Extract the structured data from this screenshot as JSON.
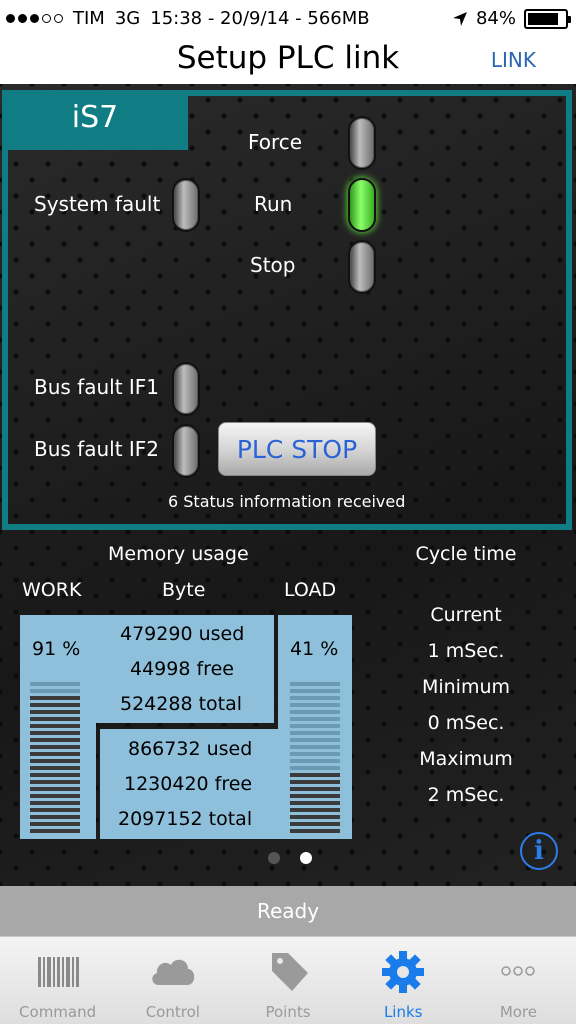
{
  "status_bar": {
    "carrier": "TIM",
    "network": "3G",
    "center_text": "15:38 - 20/9/14 - 566MB",
    "battery": "84%",
    "battery_level": 0.84,
    "signal_bars_filled": 3,
    "signal_bars_total": 5
  },
  "nav": {
    "title": "Setup PLC link",
    "right_button": "LINK"
  },
  "plc": {
    "name": "iS7",
    "indicators": {
      "force": {
        "label": "Force",
        "on": false
      },
      "system_fault": {
        "label": "System fault",
        "on": false
      },
      "run": {
        "label": "Run",
        "on": true
      },
      "stop": {
        "label": "Stop",
        "on": false
      },
      "bus_fault_if1": {
        "label": "Bus fault IF1",
        "on": false
      },
      "bus_fault_if2": {
        "label": "Bus fault IF2",
        "on": false
      }
    },
    "stop_button": "PLC STOP",
    "status_info": "6 Status information received"
  },
  "memory": {
    "title": "Memory usage",
    "work_label": "WORK",
    "byte_label": "Byte",
    "load_label": "LOAD",
    "work_percent": "91 %",
    "work_fraction": 0.91,
    "load_percent": "41 %",
    "load_fraction": 0.41,
    "work": {
      "used": "479290 used",
      "free": "44998 free",
      "total": "524288 total"
    },
    "load": {
      "used": "866732 used",
      "free": "1230420 free",
      "total": "2097152 total"
    }
  },
  "cycle": {
    "title": "Cycle time",
    "current_label": "Current",
    "current_value": "1 mSec.",
    "minimum_label": "Minimum",
    "minimum_value": "0 mSec.",
    "maximum_label": "Maximum",
    "maximum_value": "2 mSec."
  },
  "page_indicator": {
    "pages": 2,
    "active": 1
  },
  "ready_text": "Ready",
  "tabs": [
    {
      "label": "Command",
      "icon": "barcode-icon",
      "active": false
    },
    {
      "label": "Control",
      "icon": "cloud-icon",
      "active": false
    },
    {
      "label": "Points",
      "icon": "tag-icon",
      "active": false
    },
    {
      "label": "Links",
      "icon": "gear-icon",
      "active": true
    },
    {
      "label": "More",
      "icon": "more-dots-icon",
      "active": false
    }
  ],
  "colors": {
    "frame_teal": "#0f7d83",
    "panel_blue": "#8ec0dc",
    "accent_blue": "#1b7bea",
    "led_green": "#5ef03a"
  }
}
